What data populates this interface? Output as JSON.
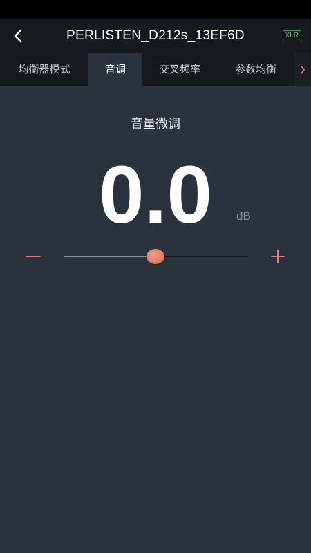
{
  "header": {
    "title": "PERLISTEN_D212s_13EF6D",
    "badge": "XLR",
    "back_icon": "chevron-left-icon"
  },
  "tabs": [
    {
      "label": "均衡器模式",
      "active": false
    },
    {
      "label": "音调",
      "active": true
    },
    {
      "label": "交叉频率",
      "active": false
    },
    {
      "label": "参数均衡",
      "active": false
    }
  ],
  "tab_more_icon": "chevron-right-icon",
  "volume": {
    "section_title": "音量微调",
    "value": "0.0",
    "unit": "dB",
    "slider_fraction": 0.5,
    "minus_icon": "minus-icon",
    "plus_icon": "plus-icon"
  },
  "colors": {
    "background": "#2a333d",
    "header": "#16191e",
    "accent": "#e27d68",
    "badge": "#4cc25c"
  }
}
